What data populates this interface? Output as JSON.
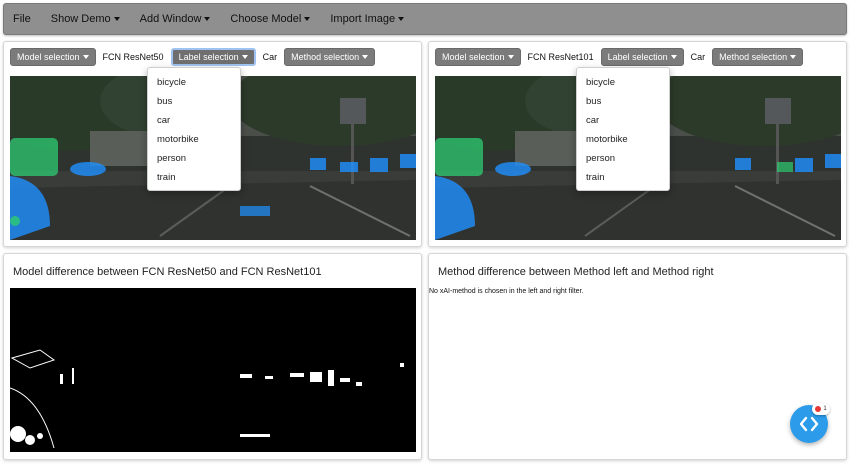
{
  "menu": {
    "file": "File",
    "show_demo": "Show Demo",
    "add_window": "Add Window",
    "choose_model": "Choose Model",
    "import_image": "Import Image"
  },
  "left_panel": {
    "model_selection": "Model selection",
    "model_name": "FCN ResNet50",
    "label_selection": "Label selection",
    "label_value": "Car",
    "method_selection": "Method selection",
    "labels": [
      "bicycle",
      "bus",
      "car",
      "motorbike",
      "person",
      "train"
    ]
  },
  "right_panel": {
    "model_selection": "Model selection",
    "model_name": "FCN ResNet101",
    "label_selection": "Label selection",
    "label_value": "Car",
    "method_selection": "Method selection",
    "labels": [
      "bicycle",
      "bus",
      "car",
      "motorbike",
      "person",
      "train"
    ]
  },
  "model_diff": {
    "title": "Model difference between FCN ResNet50 and FCN ResNet101"
  },
  "method_diff": {
    "title": "Method difference between Method left and Method right",
    "note": "No xAI-method is chosen in the left and right filter."
  },
  "fab": {
    "icon": "code-brackets-icon",
    "badge_count": "1"
  },
  "colors": {
    "menubar": "#8f8f8f",
    "button": "#7b7b7b",
    "active_outline": "#9ec3f0",
    "fab": "#2b9bea",
    "seg_blue": "#1e90ff",
    "seg_green": "#2ecc71"
  }
}
